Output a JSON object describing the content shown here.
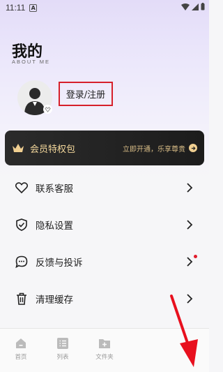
{
  "status_bar": {
    "time": "11:11",
    "notification_icon": "A"
  },
  "header": {
    "title": "我的",
    "subtitle": "ABOUT ME"
  },
  "profile": {
    "login_label": "登录/注册"
  },
  "vip": {
    "title": "会员特权包",
    "cta": "立即开通，乐享尊贵"
  },
  "menu": {
    "items": [
      {
        "label": "联系客服",
        "icon": "heart-icon"
      },
      {
        "label": "隐私设置",
        "icon": "shield-check-icon"
      },
      {
        "label": "反馈与投诉",
        "icon": "chat-bubble-icon",
        "has_notification_dot": true
      },
      {
        "label": "清理缓存",
        "icon": "trash-icon"
      }
    ]
  },
  "tabbar": {
    "items": [
      {
        "label": "首页",
        "icon": "home-icon"
      },
      {
        "label": "列表",
        "icon": "list-icon"
      },
      {
        "label": "文件夹",
        "icon": "folder-add-icon"
      }
    ]
  },
  "colors": {
    "accent_gold": "#f0cf91",
    "highlight_red": "#d6202a",
    "banner_dark": "#222222"
  }
}
